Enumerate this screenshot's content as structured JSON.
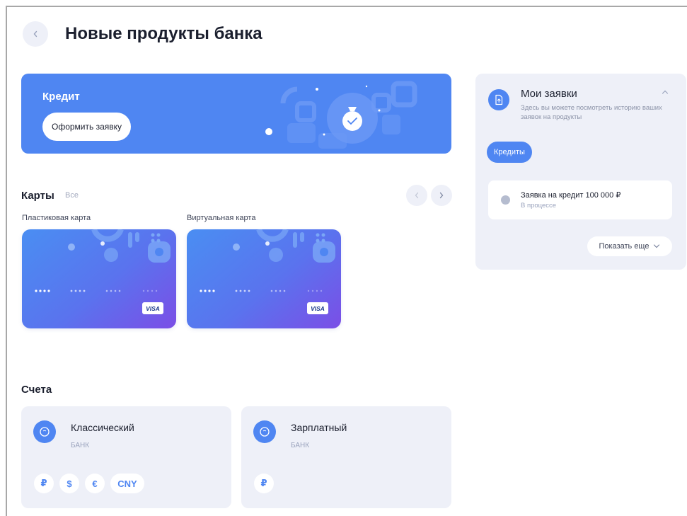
{
  "header": {
    "title": "Новые продукты банка",
    "back_icon": "chevron-left-icon"
  },
  "credit_banner": {
    "title": "Кредит",
    "button_label": "Оформить заявку",
    "accent": "#4f86f2"
  },
  "cards": {
    "title": "Карты",
    "all_link": "Все",
    "items": [
      {
        "caption": "Пластиковая карта",
        "brand": "VISA"
      },
      {
        "caption": "Виртуальная карта",
        "brand": "VISA"
      }
    ]
  },
  "accounts": {
    "title": "Счета",
    "items": [
      {
        "name": "Классический",
        "subtitle": "БАНК",
        "currencies": [
          "₽",
          "$",
          "€",
          "CNY"
        ]
      },
      {
        "name": "Зарплатный",
        "subtitle": "БАНК",
        "currencies": [
          "₽"
        ]
      }
    ]
  },
  "requests": {
    "title": "Мои заявки",
    "description": "Здесь вы можете посмотреть историю ваших заявок на продукты",
    "filter_label": "Кредиты",
    "item": {
      "title": "Заявка на кредит 100 000 ₽",
      "status": "В процессе"
    },
    "show_more": "Показать еще"
  },
  "colors": {
    "primary": "#4f86f2",
    "panel_bg": "#eef0f8",
    "card_gradient_start": "#4a8ef2",
    "card_gradient_end": "#7b4ee6"
  }
}
